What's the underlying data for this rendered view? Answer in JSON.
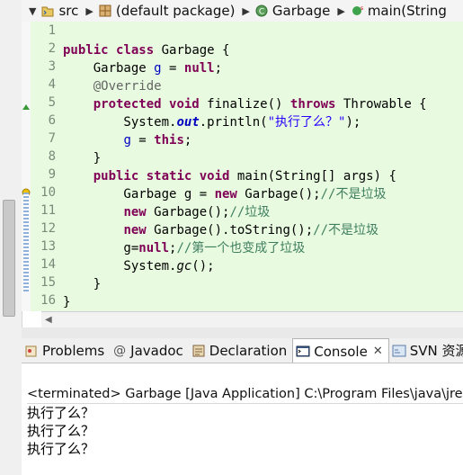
{
  "breadcrumb": {
    "items": [
      {
        "label": "src",
        "icon": "source-folder-icon"
      },
      {
        "label": "(default package)",
        "icon": "package-icon"
      },
      {
        "label": "Garbage",
        "icon": "class-icon"
      },
      {
        "label": "main(String",
        "icon": "method-icon"
      }
    ]
  },
  "editor": {
    "line_numbers": [
      "1",
      "2",
      "3",
      "4",
      "5",
      "6",
      "7",
      "8",
      "9",
      "10",
      "11",
      "12",
      "13",
      "14",
      "15",
      "16"
    ],
    "lines": [
      [
        {
          "t": "",
          "c": ""
        }
      ],
      [
        {
          "t": "public",
          "c": "kw"
        },
        {
          "t": " ",
          "c": ""
        },
        {
          "t": "class",
          "c": "kw"
        },
        {
          "t": " Garbage {",
          "c": ""
        }
      ],
      [
        {
          "t": "    Garbage ",
          "c": ""
        },
        {
          "t": "g",
          "c": "fld"
        },
        {
          "t": " = ",
          "c": ""
        },
        {
          "t": "null",
          "c": "kw"
        },
        {
          "t": ";",
          "c": ""
        }
      ],
      [
        {
          "t": "    @Override",
          "c": "ann"
        }
      ],
      [
        {
          "t": "    ",
          "c": ""
        },
        {
          "t": "protected",
          "c": "kw"
        },
        {
          "t": " ",
          "c": ""
        },
        {
          "t": "void",
          "c": "kw"
        },
        {
          "t": " finalize() ",
          "c": ""
        },
        {
          "t": "throws",
          "c": "kw"
        },
        {
          "t": " Throwable {",
          "c": ""
        }
      ],
      [
        {
          "t": "        System.",
          "c": ""
        },
        {
          "t": "out",
          "c": "stat"
        },
        {
          "t": ".println(",
          "c": ""
        },
        {
          "t": "\"执行了么？\"",
          "c": "str"
        },
        {
          "t": ");",
          "c": ""
        }
      ],
      [
        {
          "t": "        ",
          "c": ""
        },
        {
          "t": "g",
          "c": "fld"
        },
        {
          "t": " = ",
          "c": ""
        },
        {
          "t": "this",
          "c": "kw"
        },
        {
          "t": ";",
          "c": ""
        }
      ],
      [
        {
          "t": "    }",
          "c": ""
        }
      ],
      [
        {
          "t": "    ",
          "c": ""
        },
        {
          "t": "public",
          "c": "kw"
        },
        {
          "t": " ",
          "c": ""
        },
        {
          "t": "static",
          "c": "kw"
        },
        {
          "t": " ",
          "c": ""
        },
        {
          "t": "void",
          "c": "kw"
        },
        {
          "t": " main(String[] args) {",
          "c": ""
        }
      ],
      [
        {
          "t": "        Garbage g = ",
          "c": ""
        },
        {
          "t": "new",
          "c": "kw"
        },
        {
          "t": " Garbage();",
          "c": ""
        },
        {
          "t": "//不是垃圾",
          "c": "cmt"
        }
      ],
      [
        {
          "t": "        ",
          "c": ""
        },
        {
          "t": "new",
          "c": "kw"
        },
        {
          "t": " Garbage();",
          "c": ""
        },
        {
          "t": "//垃圾",
          "c": "cmt"
        }
      ],
      [
        {
          "t": "        ",
          "c": ""
        },
        {
          "t": "new",
          "c": "kw"
        },
        {
          "t": " Garbage().toString();",
          "c": ""
        },
        {
          "t": "//不是垃圾",
          "c": "cmt"
        }
      ],
      [
        {
          "t": "        g=",
          "c": ""
        },
        {
          "t": "null",
          "c": "kw"
        },
        {
          "t": ";",
          "c": ""
        },
        {
          "t": "//第一个也变成了垃圾",
          "c": "cmt"
        }
      ],
      [
        {
          "t": "        System.",
          "c": ""
        },
        {
          "t": "gc",
          "c": "ital"
        },
        {
          "t": "();",
          "c": ""
        }
      ],
      [
        {
          "t": "    }",
          "c": ""
        }
      ],
      [
        {
          "t": "}",
          "c": ""
        }
      ]
    ]
  },
  "views": {
    "tabs": [
      {
        "label": "Problems",
        "icon": "problems-icon",
        "active": false
      },
      {
        "label": "Javadoc",
        "icon": "javadoc-icon",
        "active": false
      },
      {
        "label": "Declaration",
        "icon": "declaration-icon",
        "active": false
      },
      {
        "label": "Console",
        "icon": "console-icon",
        "active": true,
        "close": "✕"
      },
      {
        "label": "SVN 资源",
        "icon": "svn-icon",
        "active": false
      }
    ]
  },
  "console": {
    "header": "<terminated> Garbage [Java Application] C:\\Program Files\\java\\jre",
    "output": [
      "执行了么？",
      "执行了么？",
      "执行了么？"
    ]
  },
  "colors": {
    "editor_bg": "#e8fbe0",
    "keyword": "#7f0055",
    "comment": "#3f7f5f",
    "string": "#2a00ff",
    "field": "#0000c0"
  }
}
